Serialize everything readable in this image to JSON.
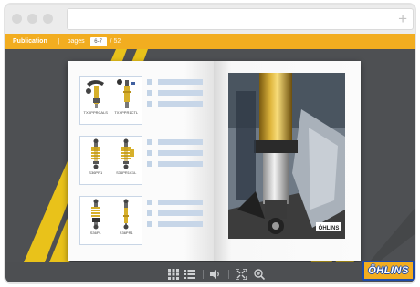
{
  "browser": {
    "address_value": "",
    "new_tab_symbol": "+"
  },
  "toolbar": {
    "publication_label": "Publication",
    "separator": "|",
    "pages_label": "pages",
    "page_value": "6-7",
    "total_pages": "/ 52"
  },
  "catalog": {
    "products": [
      {
        "left_label": "TXXPPRCALS",
        "right_label": "TXXPPR1CTL"
      },
      {
        "left_label": "S36PR1",
        "right_label": "S36PR1C1L"
      },
      {
        "left_label": "S36PL",
        "right_label": "S36PR1"
      }
    ]
  },
  "photo": {
    "logo_text": "ÖHLINS"
  },
  "controls": {
    "icons": [
      "thumbnails-grid-icon",
      "list-icon",
      "volume-icon",
      "fullscreen-icon",
      "zoom-in-icon"
    ]
  },
  "brand": {
    "logo_text": "ÖHLINS",
    "accent_color": "#f2ad20",
    "logo_border_color": "#1e4aa8"
  }
}
